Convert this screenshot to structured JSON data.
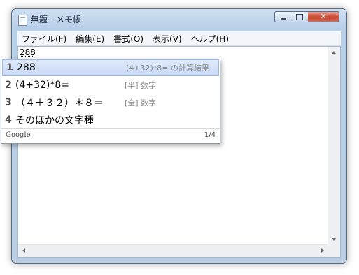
{
  "window": {
    "title": "無題 - メモ帳",
    "minimize_icon": "minimize-icon",
    "maximize_icon": "maximize-icon",
    "close_icon": "close-icon",
    "close_glyph": "✕"
  },
  "menu": [
    "ファイル(F)",
    "編集(E)",
    "書式(O)",
    "表示(V)",
    "ヘルプ(H)"
  ],
  "editor": {
    "text": "288"
  },
  "ime": {
    "candidates": [
      {
        "num": "1",
        "text": "288",
        "note": "(4+32)*8= の計算結果",
        "selected": true
      },
      {
        "num": "2",
        "text": "(4+32)*8=",
        "note": "[半] 数字",
        "selected": false
      },
      {
        "num": "3",
        "text": "（４＋３２）＊８＝",
        "note": "[全] 数字",
        "selected": false
      },
      {
        "num": "4",
        "text": "そのほかの文字種",
        "note": "",
        "selected": false
      }
    ],
    "brand": "Google",
    "page": "1/4"
  },
  "colors": {
    "selection": "#c8daf7",
    "title_bar": "#b8cfe8",
    "close_button": "#c7442e"
  }
}
